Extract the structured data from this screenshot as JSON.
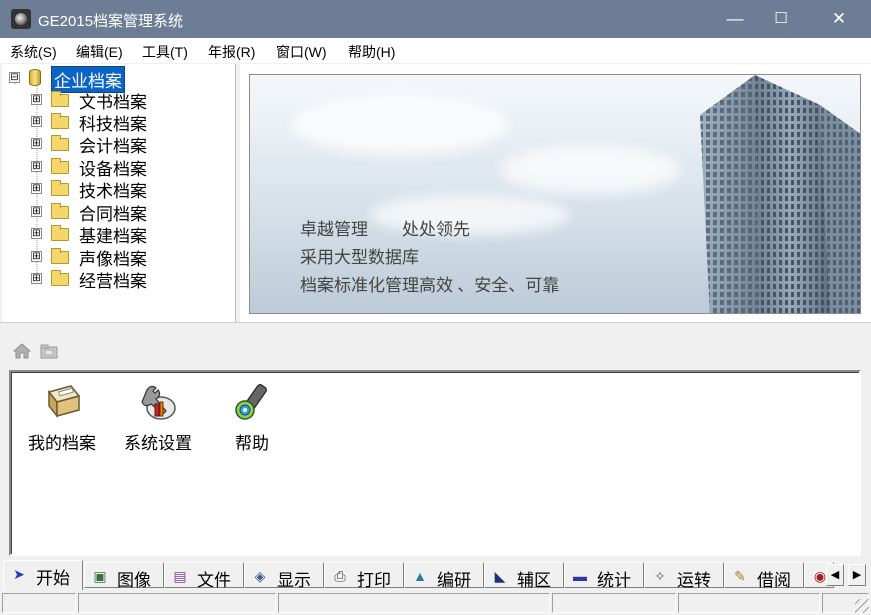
{
  "window": {
    "title": "GE2015档案管理系统",
    "minimize": "—",
    "maximize": "☐",
    "close": "✕"
  },
  "menu": [
    "系统(S)",
    "编辑(E)",
    "工具(T)",
    "年报(R)",
    "窗口(W)",
    "帮助(H)"
  ],
  "tree": {
    "root": "企业档案",
    "root_expander": "⊟",
    "expander": "⊞",
    "items": [
      "文书档案",
      "科技档案",
      "会计档案",
      "设备档案",
      "技术档案",
      "合同档案",
      "基建档案",
      "声像档案",
      "经营档案"
    ]
  },
  "banner": {
    "lines": [
      "卓越管理　　处处领先",
      "采用大型数据库",
      "档案标准化管理高效 、安全、可靠"
    ]
  },
  "nav_icons": [
    "home-icon",
    "folder-nav-icon"
  ],
  "shortcuts": [
    {
      "label": "我的档案",
      "icon": "archive-box-icon"
    },
    {
      "label": "系统设置",
      "icon": "settings-tools-icon"
    },
    {
      "label": "帮助",
      "icon": "help-flashlight-icon"
    }
  ],
  "tabs": [
    {
      "label": "开始",
      "icon": "start-arrow-icon",
      "glyph": "➤",
      "color": "#1f3fbf"
    },
    {
      "label": "图像",
      "icon": "image-icon",
      "glyph": "▣",
      "color": "#3f6f3f"
    },
    {
      "label": "文件",
      "icon": "file-icon",
      "glyph": "▤",
      "color": "#7a3fa0"
    },
    {
      "label": "显示",
      "icon": "display-icon",
      "glyph": "◈",
      "color": "#3b5c8a"
    },
    {
      "label": "打印",
      "icon": "printer-icon",
      "glyph": "⎙",
      "color": "#444444"
    },
    {
      "label": "编研",
      "icon": "research-icon",
      "glyph": "▲",
      "color": "#2f7a9a"
    },
    {
      "label": "辅区",
      "icon": "chart-icon",
      "glyph": "◣",
      "color": "#20307a"
    },
    {
      "label": "统计",
      "icon": "statistics-icon",
      "glyph": "▬",
      "color": "#2a3aa0"
    },
    {
      "label": "运转",
      "icon": "transfer-icon",
      "glyph": "✧",
      "color": "#7a6a3a"
    },
    {
      "label": "借阅",
      "icon": "borrow-icon",
      "glyph": "✎",
      "color": "#b07a20"
    }
  ],
  "tab_scroll": {
    "left": "◀",
    "right": "▶",
    "partial_icon_glyph": "◉"
  }
}
